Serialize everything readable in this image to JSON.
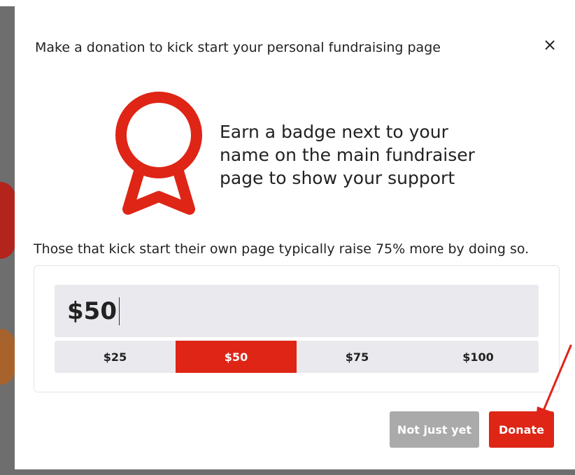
{
  "modal": {
    "title": "Make a donation to kick start your personal fundraising page",
    "close_icon": "×",
    "badge_text": "Earn a badge next to your name on the main fundraiser page to show your support",
    "kick_text": "Those that kick start their own page typically raise 75% more by doing so.",
    "amount": {
      "value": "$50"
    },
    "presets": [
      {
        "label": "$25",
        "selected": false
      },
      {
        "label": "$50",
        "selected": true
      },
      {
        "label": "$75",
        "selected": false
      },
      {
        "label": "$100",
        "selected": false
      }
    ],
    "buttons": {
      "not_now": "Not just yet",
      "donate": "Donate"
    }
  },
  "colors": {
    "accent": "#de2516",
    "disabled_button": "#aaaaaa",
    "input_bg": "#e9e9ee",
    "annotation_arrow": "#e0241a"
  },
  "icons": {
    "badge": "award-ribbon-icon",
    "close": "close-icon",
    "annotation": "red-arrow-icon"
  }
}
